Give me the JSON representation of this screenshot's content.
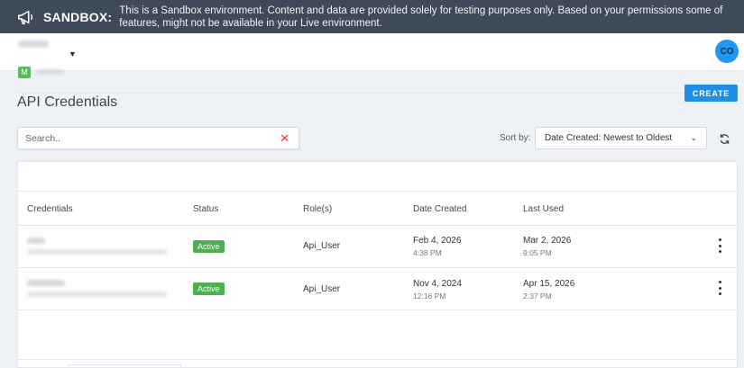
{
  "banner": {
    "title": "SANDBOX:",
    "message": "This is a Sandbox environment. Content and data are provided solely for testing purposes only. Based on your permissions some of features, might not be available in your Live environment.",
    "icon": "megaphone-icon"
  },
  "topbar": {
    "org_badge": "M",
    "avatar_initials": "CO"
  },
  "page": {
    "title": "API Credentials",
    "create_label": "CREATE"
  },
  "search": {
    "placeholder": "Search.."
  },
  "sort": {
    "label": "Sort by:",
    "selected": "Date Created: Newest to Oldest"
  },
  "table": {
    "headers": {
      "credentials": "Credentials",
      "status": "Status",
      "roles": "Role(s)",
      "date_created": "Date Created",
      "last_used": "Last Used"
    },
    "rows": [
      {
        "status": "Active",
        "role": "Api_User",
        "created_date": "Feb 4, 2026",
        "created_time": "4:38 PM",
        "used_date": "Mar 2, 2026",
        "used_time": "9:05 PM"
      },
      {
        "status": "Active",
        "role": "Api_User",
        "created_date": "Nov 4, 2024",
        "created_time": "12:16 PM",
        "used_date": "Apr 15, 2026",
        "used_time": "2:37 PM"
      }
    ]
  },
  "colors": {
    "banner_bg": "#3e4a57",
    "accent": "#1e8ee9",
    "active_badge": "#4caf50",
    "clear_icon": "#e53935"
  }
}
